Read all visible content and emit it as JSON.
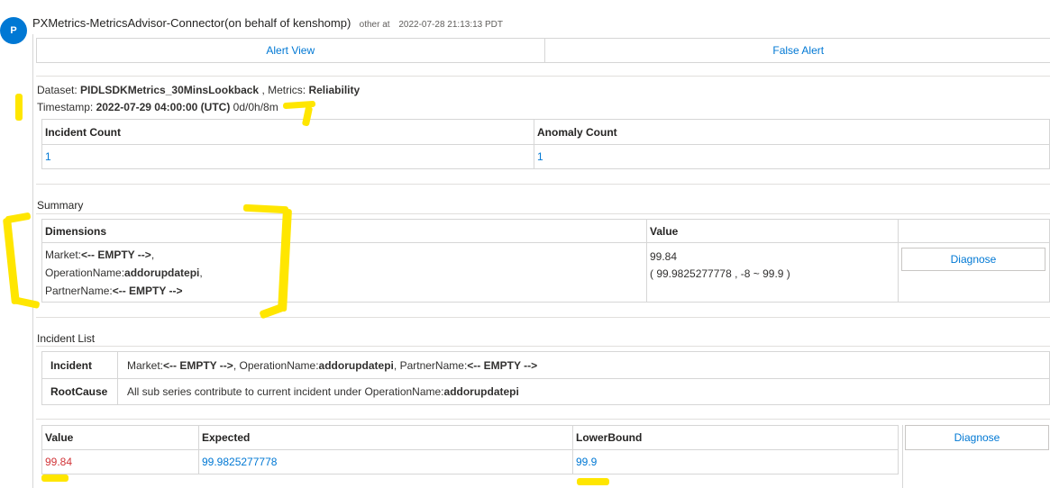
{
  "message": {
    "avatar_initial": "P",
    "sender": "PXMetrics-MetricsAdvisor-Connector(on behalf of kenshomp)",
    "label": "other at",
    "timestamp": "2022-07-28 21:13:13 PDT"
  },
  "actions": {
    "alert_view": "Alert View",
    "false_alert": "False Alert"
  },
  "dataset_line": {
    "dataset_label": "Dataset:",
    "dataset_value": "PIDLSDKMetrics_30MinsLookback",
    "metrics_label": ", Metrics:",
    "metrics_value": "Reliability",
    "timestamp_label": "Timestamp:",
    "timestamp_value": "2022-07-29 04:00:00 (UTC)",
    "duration": "0d/0h/8m"
  },
  "counts": {
    "headers": [
      "Incident Count",
      "Anomaly Count"
    ],
    "values": [
      "1",
      "1"
    ]
  },
  "summary": {
    "title": "Summary",
    "headers": [
      "Dimensions",
      "Value"
    ],
    "dims": [
      {
        "key": "Market:",
        "value": "<-- EMPTY -->",
        "sep": ","
      },
      {
        "key": "OperationName:",
        "value": "addorupdatepi",
        "sep": ","
      },
      {
        "key": "PartnerName:",
        "value": "<-- EMPTY -->",
        "sep": ""
      }
    ],
    "value": "99.84",
    "range": "( 99.9825277778 , -8 ~ 99.9 )",
    "diagnose": "Diagnose"
  },
  "incident_list": {
    "title": "Incident List",
    "incident_label": "Incident",
    "incident_parts": {
      "market_key": "Market:",
      "market_val": "<-- EMPTY -->",
      "sep1": ",",
      "op_key": "OperationName:",
      "op_val": "addorupdatepi",
      "sep2": ",",
      "partner_key": "PartnerName:",
      "partner_val": "<-- EMPTY -->"
    },
    "rootcause_label": "RootCause",
    "rootcause_text": "All sub series contribute to current incident under OperationName:",
    "rootcause_value": "addorupdatepi"
  },
  "detail": {
    "headers": [
      "Value",
      "Expected",
      "LowerBound"
    ],
    "values": [
      "99.84",
      "99.9825277778",
      "99.9"
    ],
    "diagnose": "Diagnose"
  },
  "colors": {
    "accent": "#0078d4",
    "anomaly": "#d13438",
    "highlight": "#ffe600"
  }
}
